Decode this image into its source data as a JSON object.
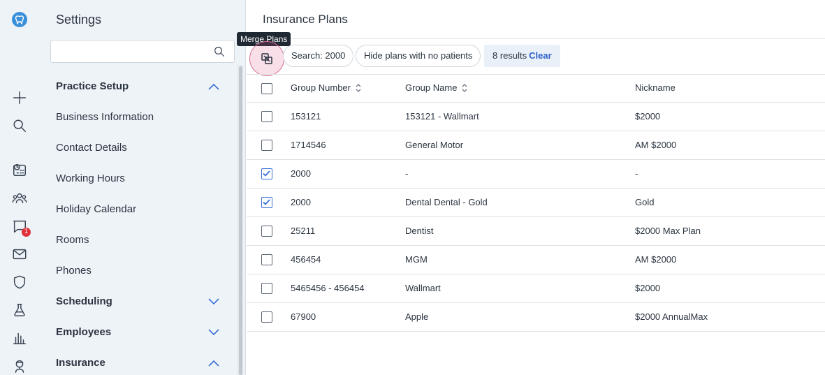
{
  "rail": {
    "logo": "tooth-logo-icon",
    "icons": [
      "plus-icon",
      "search-icon",
      "schedule-icon",
      "patients-icon",
      "chat-icon",
      "mail-icon",
      "shield-icon",
      "lab-flask-icon",
      "reports-chart-icon",
      "person-icon"
    ],
    "chat_badge": "1"
  },
  "settings": {
    "title": "Settings",
    "search_value": "",
    "sections": [
      {
        "label": "Practice Setup",
        "expanded": true
      },
      {
        "label": "Scheduling",
        "expanded": false
      },
      {
        "label": "Employees",
        "expanded": false
      },
      {
        "label": "Insurance",
        "expanded": true
      }
    ],
    "practice_items": [
      "Business Information",
      "Contact Details",
      "Working Hours",
      "Holiday Calendar",
      "Rooms",
      "Phones"
    ]
  },
  "main": {
    "title": "Insurance Plans",
    "tooltip": "Merge Plans",
    "chips": {
      "search": "Search: 2000",
      "hide": "Hide plans with no patients"
    },
    "results": {
      "count_text": "8 results",
      "clear": "Clear"
    },
    "columns": {
      "group_number": "Group Number",
      "group_name": "Group Name",
      "nickname": "Nickname"
    },
    "rows": [
      {
        "group_number": "153121",
        "group_name": "153121 - Wallmart",
        "nickname": "$2000",
        "checked": false
      },
      {
        "group_number": "1714546",
        "group_name": "General Motor",
        "nickname": "AM $2000",
        "checked": false
      },
      {
        "group_number": "2000",
        "group_name": "-",
        "nickname": "-",
        "checked": true
      },
      {
        "group_number": "2000",
        "group_name": "Dental Dental - Gold",
        "nickname": "Gold",
        "checked": true
      },
      {
        "group_number": "25211",
        "group_name": "Dentist",
        "nickname": "$2000 Max Plan",
        "checked": false
      },
      {
        "group_number": "456454",
        "group_name": "MGM",
        "nickname": "AM $2000",
        "checked": false
      },
      {
        "group_number": "5465456 - 456454",
        "group_name": "Wallmart",
        "nickname": "$2000",
        "checked": false
      },
      {
        "group_number": "67900",
        "group_name": "Apple",
        "nickname": "$2000 AnnualMax",
        "checked": false
      }
    ]
  }
}
